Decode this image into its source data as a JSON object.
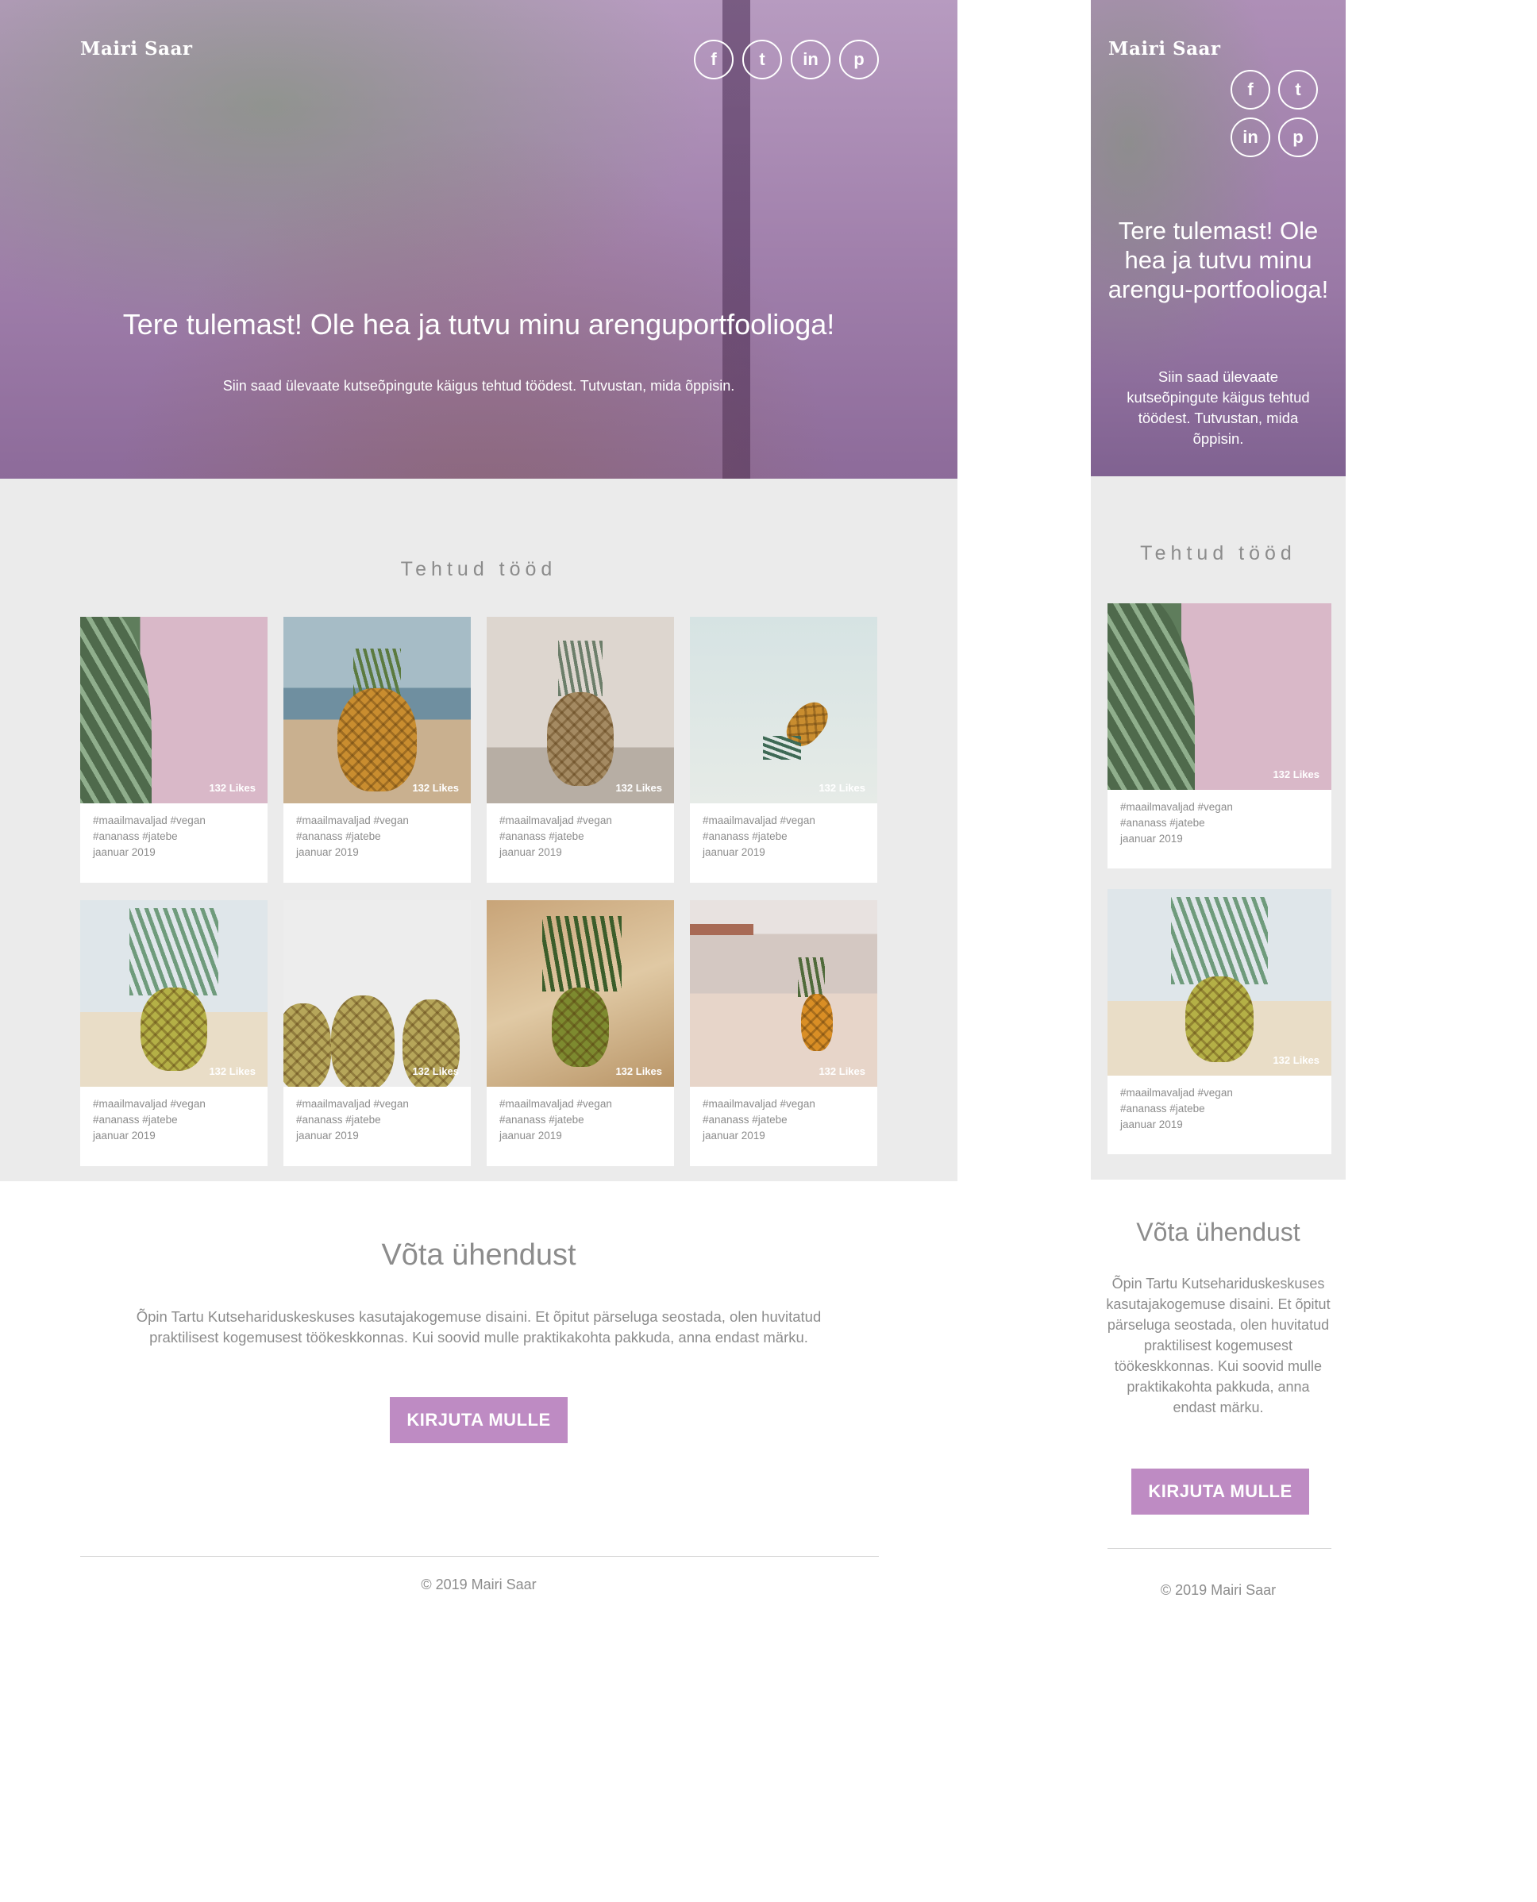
{
  "brand": {
    "name": "Mairi Saar"
  },
  "social": [
    {
      "icon": "facebook-icon",
      "glyph": "f"
    },
    {
      "icon": "twitter-icon",
      "glyph": "t"
    },
    {
      "icon": "linkedin-icon",
      "glyph": "in"
    },
    {
      "icon": "pinterest-icon",
      "glyph": "p"
    }
  ],
  "hero": {
    "title": "Tere tulemast! Ole hea ja tutvu minu arenguportfoolioga!",
    "subtitle": "Siin saad ülevaate kutseõpingute käigus tehtud töödest. Tutvustan, mida õppisin.",
    "mobile_title": "Tere tulemast! Ole hea ja tutvu minu arengu-portfoolioga!",
    "mobile_subtitle": "Siin saad ülevaate kutseõpingute käigus tehtud töödest. Tutvustan, mida õppisin."
  },
  "works": {
    "title": "Tehtud tööd",
    "items": [
      {
        "likes": "132 Likes",
        "tags1": "#maailmavaljad #vegan",
        "tags2": "#ananass #jatebe",
        "date": "jaanuar 2019"
      },
      {
        "likes": "132 Likes",
        "tags1": "#maailmavaljad #vegan",
        "tags2": "#ananass #jatebe",
        "date": "jaanuar 2019"
      },
      {
        "likes": "132 Likes",
        "tags1": "#maailmavaljad #vegan",
        "tags2": "#ananass #jatebe",
        "date": "jaanuar 2019"
      },
      {
        "likes": "132 Likes",
        "tags1": "#maailmavaljad #vegan",
        "tags2": "#ananass #jatebe",
        "date": "jaanuar 2019"
      },
      {
        "likes": "132 Likes",
        "tags1": "#maailmavaljad #vegan",
        "tags2": "#ananass #jatebe",
        "date": "jaanuar 2019"
      },
      {
        "likes": "132 Likes",
        "tags1": "#maailmavaljad #vegan",
        "tags2": "#ananass #jatebe",
        "date": "jaanuar 2019"
      },
      {
        "likes": "132 Likes",
        "tags1": "#maailmavaljad #vegan",
        "tags2": "#ananass #jatebe",
        "date": "jaanuar 2019"
      },
      {
        "likes": "132 Likes",
        "tags1": "#maailmavaljad #vegan",
        "tags2": "#ananass #jatebe",
        "date": "jaanuar 2019"
      }
    ]
  },
  "contact": {
    "title": "Võta ühendust",
    "text": "Õpin Tartu Kutsehariduskeskuses kasutajakogemuse disaini. Et õpitut pärseluga seostada, olen huvitatud praktilisest kogemusest töökeskkonnas. Kui soovid mulle praktikakohta pakkuda, anna endast märku.",
    "button": "KIRJUTA MULLE"
  },
  "footer": {
    "copyright": "© 2019 Mairi Saar"
  },
  "colors": {
    "accent": "#be8bc3",
    "works_bg": "#ebebeb",
    "text": "#8c8c8c"
  }
}
